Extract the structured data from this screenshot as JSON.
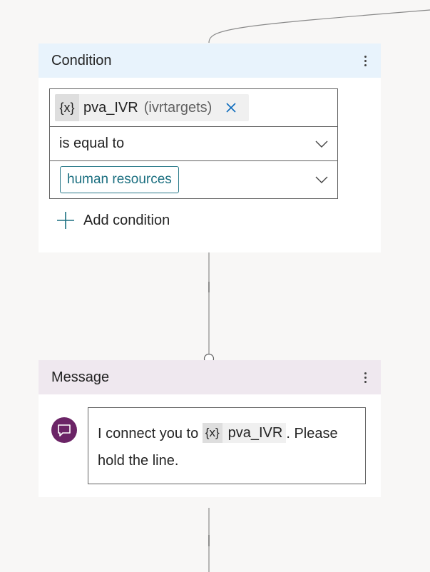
{
  "colors": {
    "canvas": "#f8f7f6",
    "condition_header": "#e8f3fc",
    "message_header": "#efe8ef",
    "bot_avatar": "#6b2466",
    "value_tag": "#1b6f80"
  },
  "condition": {
    "title": "Condition",
    "menu_icon": "more-vertical-icon",
    "variable": {
      "icon_text": "{x}",
      "name": "pva_IVR",
      "type": "(ivrtargets)",
      "remove_icon": "close-icon"
    },
    "operator": "is equal to",
    "value": "human resources",
    "add_condition_label": "Add condition"
  },
  "message": {
    "title": "Message",
    "menu_icon": "more-vertical-icon",
    "avatar_icon": "chat-bubble-icon",
    "text_before": "I connect you to ",
    "variable_icon_text": "{x}",
    "variable_name": "pva_IVR",
    "text_after": ". Please hold the line."
  }
}
